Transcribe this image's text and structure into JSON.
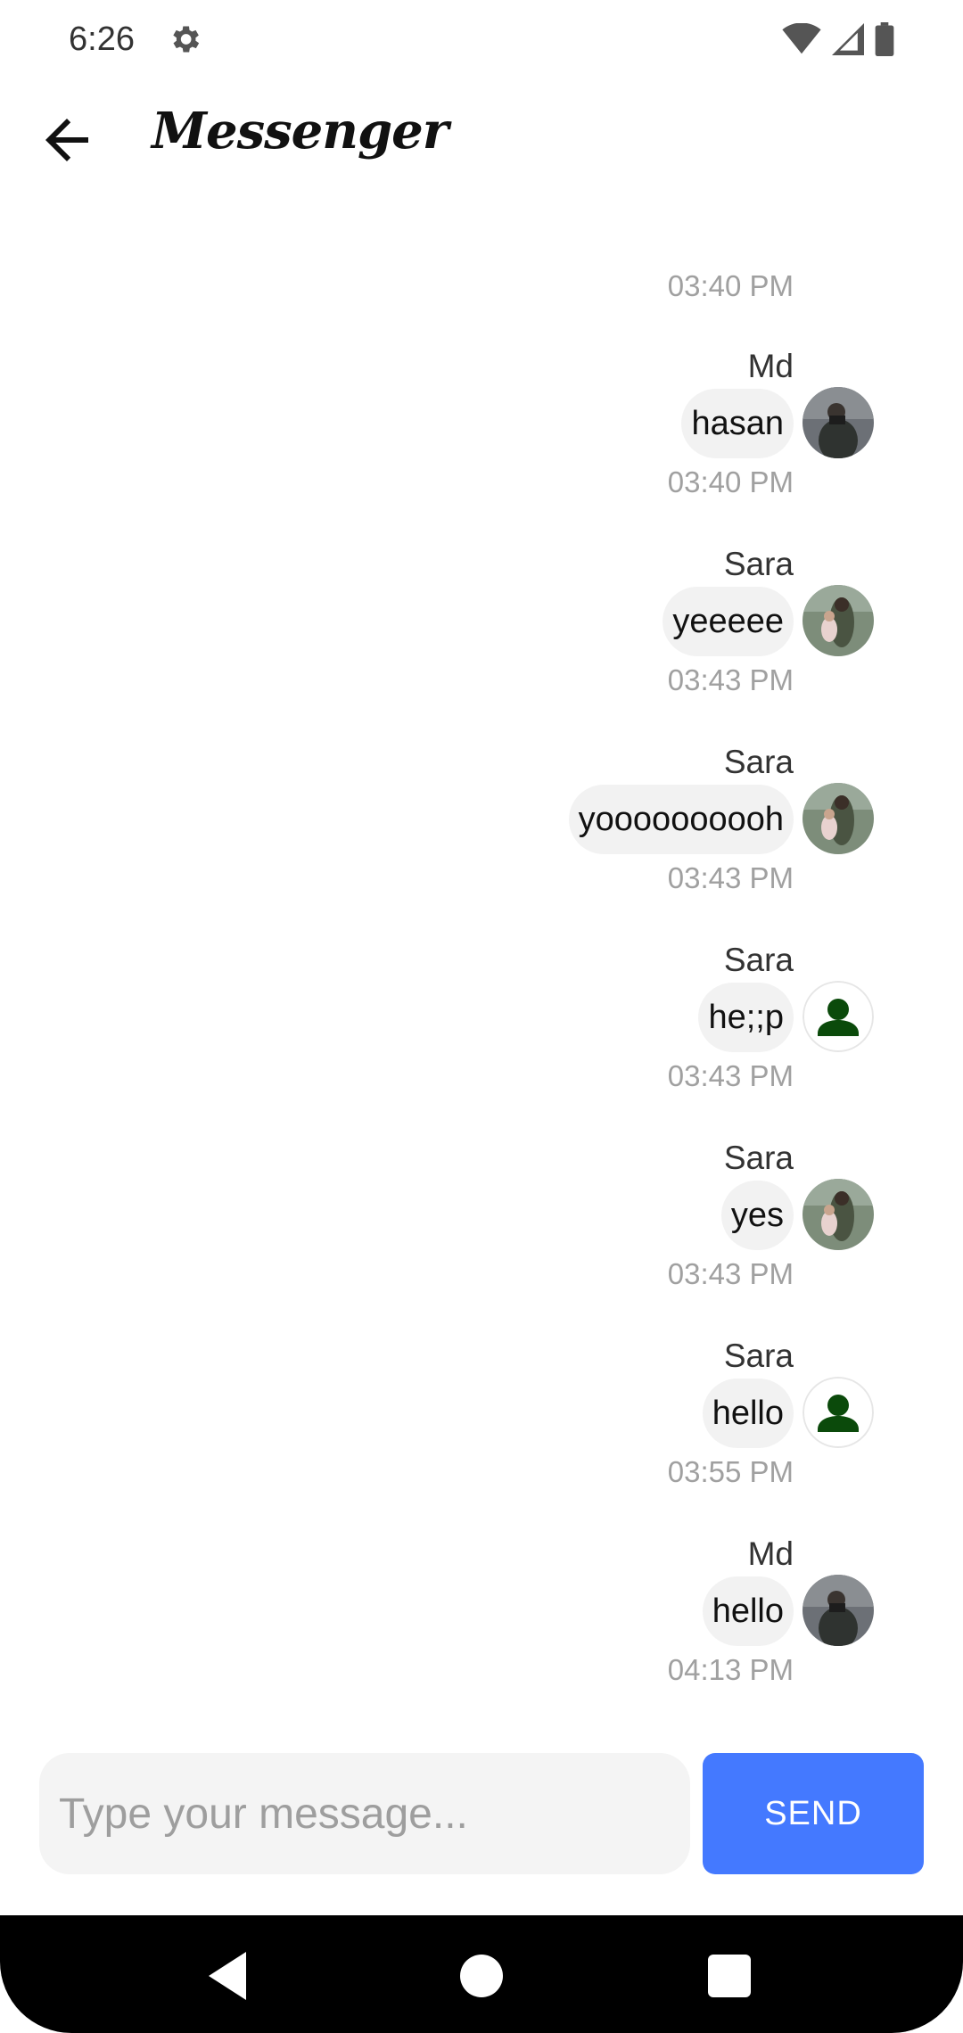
{
  "status_bar": {
    "time": "6:26"
  },
  "app_bar": {
    "title": "Messenger"
  },
  "first_timestamp": "03:40 PM",
  "messages": [
    {
      "name": "Md",
      "text": "hasan",
      "time": "03:40 PM",
      "avatar": "photo-man"
    },
    {
      "name": "Sara",
      "text": "yeeeee",
      "time": "03:43 PM",
      "avatar": "photo-woman"
    },
    {
      "name": "Sara",
      "text": "yoooooooooh",
      "time": "03:43 PM",
      "avatar": "photo-woman"
    },
    {
      "name": "Sara",
      "text": "he;;p",
      "time": "03:43 PM",
      "avatar": "person-icon"
    },
    {
      "name": "Sara",
      "text": "yes",
      "time": "03:43 PM",
      "avatar": "photo-woman"
    },
    {
      "name": "Sara",
      "text": "hello",
      "time": "03:55 PM",
      "avatar": "person-icon"
    },
    {
      "name": "Md",
      "text": "hello",
      "time": "04:13 PM",
      "avatar": "photo-man"
    }
  ],
  "composer": {
    "placeholder": "Type your message...",
    "send_label": "SEND"
  },
  "colors": {
    "accent": "#4479ff",
    "bubble": "#f2f2f2",
    "person_icon": "#0b4a0b"
  }
}
